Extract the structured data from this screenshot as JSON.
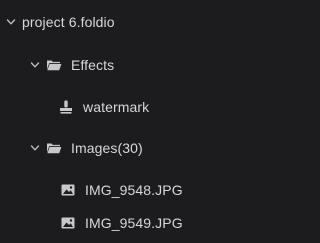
{
  "tree": {
    "root": {
      "label": "project 6.foldio",
      "icon": "chevron-down-icon",
      "expanded": true
    },
    "effects": {
      "label": "Effects",
      "icon": "folder-icon",
      "expanded": true
    },
    "watermark": {
      "label": "watermark",
      "icon": "stamp-icon"
    },
    "images": {
      "label": "Images(30)",
      "icon": "folder-icon",
      "expanded": true
    },
    "files": [
      {
        "label": "IMG_9548.JPG",
        "icon": "image-file-icon"
      },
      {
        "label": "IMG_9549.JPG",
        "icon": "image-file-icon"
      }
    ]
  },
  "colors": {
    "background": "#1c1c1e",
    "text": "#d8d8d8",
    "icon": "#c8c8c8"
  }
}
